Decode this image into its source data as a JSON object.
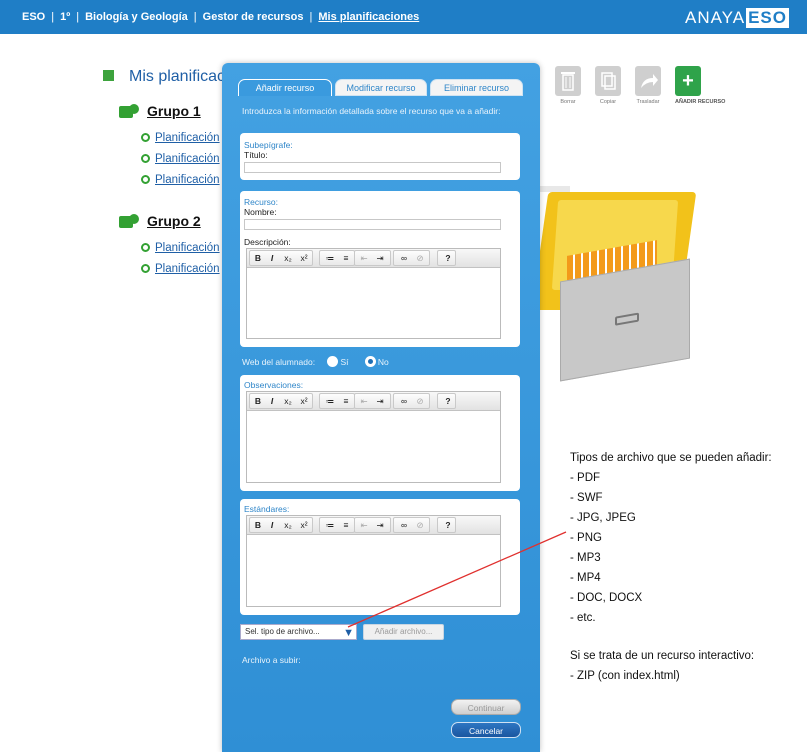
{
  "topbar": {
    "crumbs": [
      "ESO",
      "1º",
      "Biología y Geología",
      "Gestor de recursos",
      "Mis planificaciones"
    ],
    "separator": "|",
    "brand_prefix": "ANAYA",
    "brand_suffix": "ESO"
  },
  "background": {
    "title": "Mis planificaciones",
    "groups": [
      {
        "label": "Grupo 1",
        "plans": [
          "Planificación",
          "Planificación",
          "Planificación"
        ]
      },
      {
        "label": "Grupo 2",
        "plans": [
          "Planificación",
          "Planificación"
        ]
      }
    ],
    "tools": [
      {
        "icon": "trash-icon",
        "label": "Borrar"
      },
      {
        "icon": "copy-icon",
        "label": "Copiar"
      },
      {
        "icon": "share-icon",
        "label": "Trasladar"
      },
      {
        "icon": "plus-icon",
        "label": "AÑADIR RECURSO"
      }
    ]
  },
  "modal": {
    "tabs": [
      "Añadir recurso",
      "Modificar recurso",
      "Eliminar recurso"
    ],
    "intro": "Introduzca la información detallada sobre el recurso que va a añadir:",
    "subepigrafe": {
      "title": "Subepígrafe:",
      "field_label": "Título:",
      "value": ""
    },
    "recurso": {
      "title": "Recurso:",
      "name_label": "Nombre:",
      "name_value": "",
      "desc_label": "Descripción:"
    },
    "web": {
      "label": "Web del alumnado:",
      "options": [
        "Sí",
        "No"
      ],
      "selected": "No"
    },
    "observaciones": {
      "title": "Observaciones:"
    },
    "estandares": {
      "title": "Estándares:"
    },
    "toolbar_buttons": [
      "B",
      "I",
      "x₂",
      "x²",
      "≔",
      "≡",
      "⇤",
      "⇥",
      "∞",
      "⊘",
      "?"
    ],
    "file_select": "Sel. tipo de archivo...",
    "add_file": "Añadir archivo...",
    "file_label": "Archivo a subir:",
    "continue": "Continuar",
    "cancel": "Cancelar"
  },
  "annotation": {
    "heading": "Tipos de archivo que se pueden añadir:",
    "types": [
      "- PDF",
      "- SWF",
      "- JPG, JPEG",
      "- PNG",
      "- MP3",
      "- MP4",
      "- DOC, DOCX",
      "- etc."
    ],
    "interactive_heading": "Si se trata de un recurso interactivo:",
    "interactive_item": "- ZIP (con index.html)"
  },
  "colors": {
    "topbar": "#1f7ec6",
    "modal": "#3a9ade",
    "accent_green": "#33a133",
    "annotation_line": "#e0302e"
  }
}
